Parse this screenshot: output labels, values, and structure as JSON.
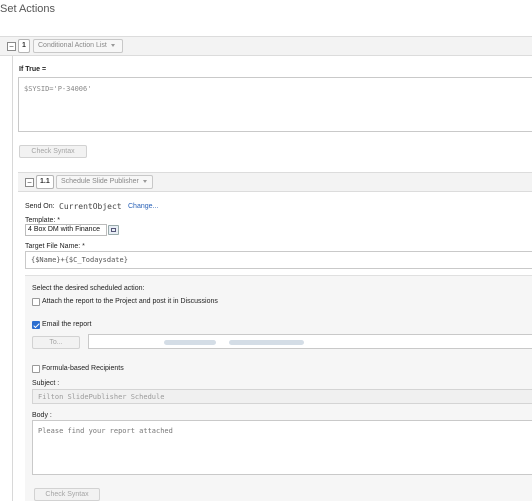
{
  "title": "Set Actions",
  "block1": {
    "index": "1",
    "dropdown": "Conditional Action List",
    "collapse_glyph": "⊟"
  },
  "if_true": {
    "label": "If True =",
    "expression": "$SYSID='P-34006'"
  },
  "check_syntax": "Check Syntax",
  "block11": {
    "index": "1.1",
    "dropdown": "Schedule Slide Publisher",
    "collapse_glyph": "⊟"
  },
  "send_on": {
    "label": "Send On:",
    "value": "CurrentObject",
    "link": "Change..."
  },
  "template": {
    "label": "Template: *",
    "value": "4 Box DM with Finance"
  },
  "target_file": {
    "label": "Target File Name: *",
    "value": "{$Name}+{$C_Todaysdate}"
  },
  "scheduled": {
    "heading": "Select the desired scheduled action:",
    "attach_label": "Attach the report to the Project and post it in Discussions",
    "email_label": "Email the report",
    "email_checked": true,
    "to_button": "To...",
    "formula_label": "Formula-based Recipients",
    "subject_label": "Subject :",
    "subject_value": "Filton SlidePublisher Schedule",
    "body_label": "Body :",
    "body_value": "Please find your report attached"
  }
}
